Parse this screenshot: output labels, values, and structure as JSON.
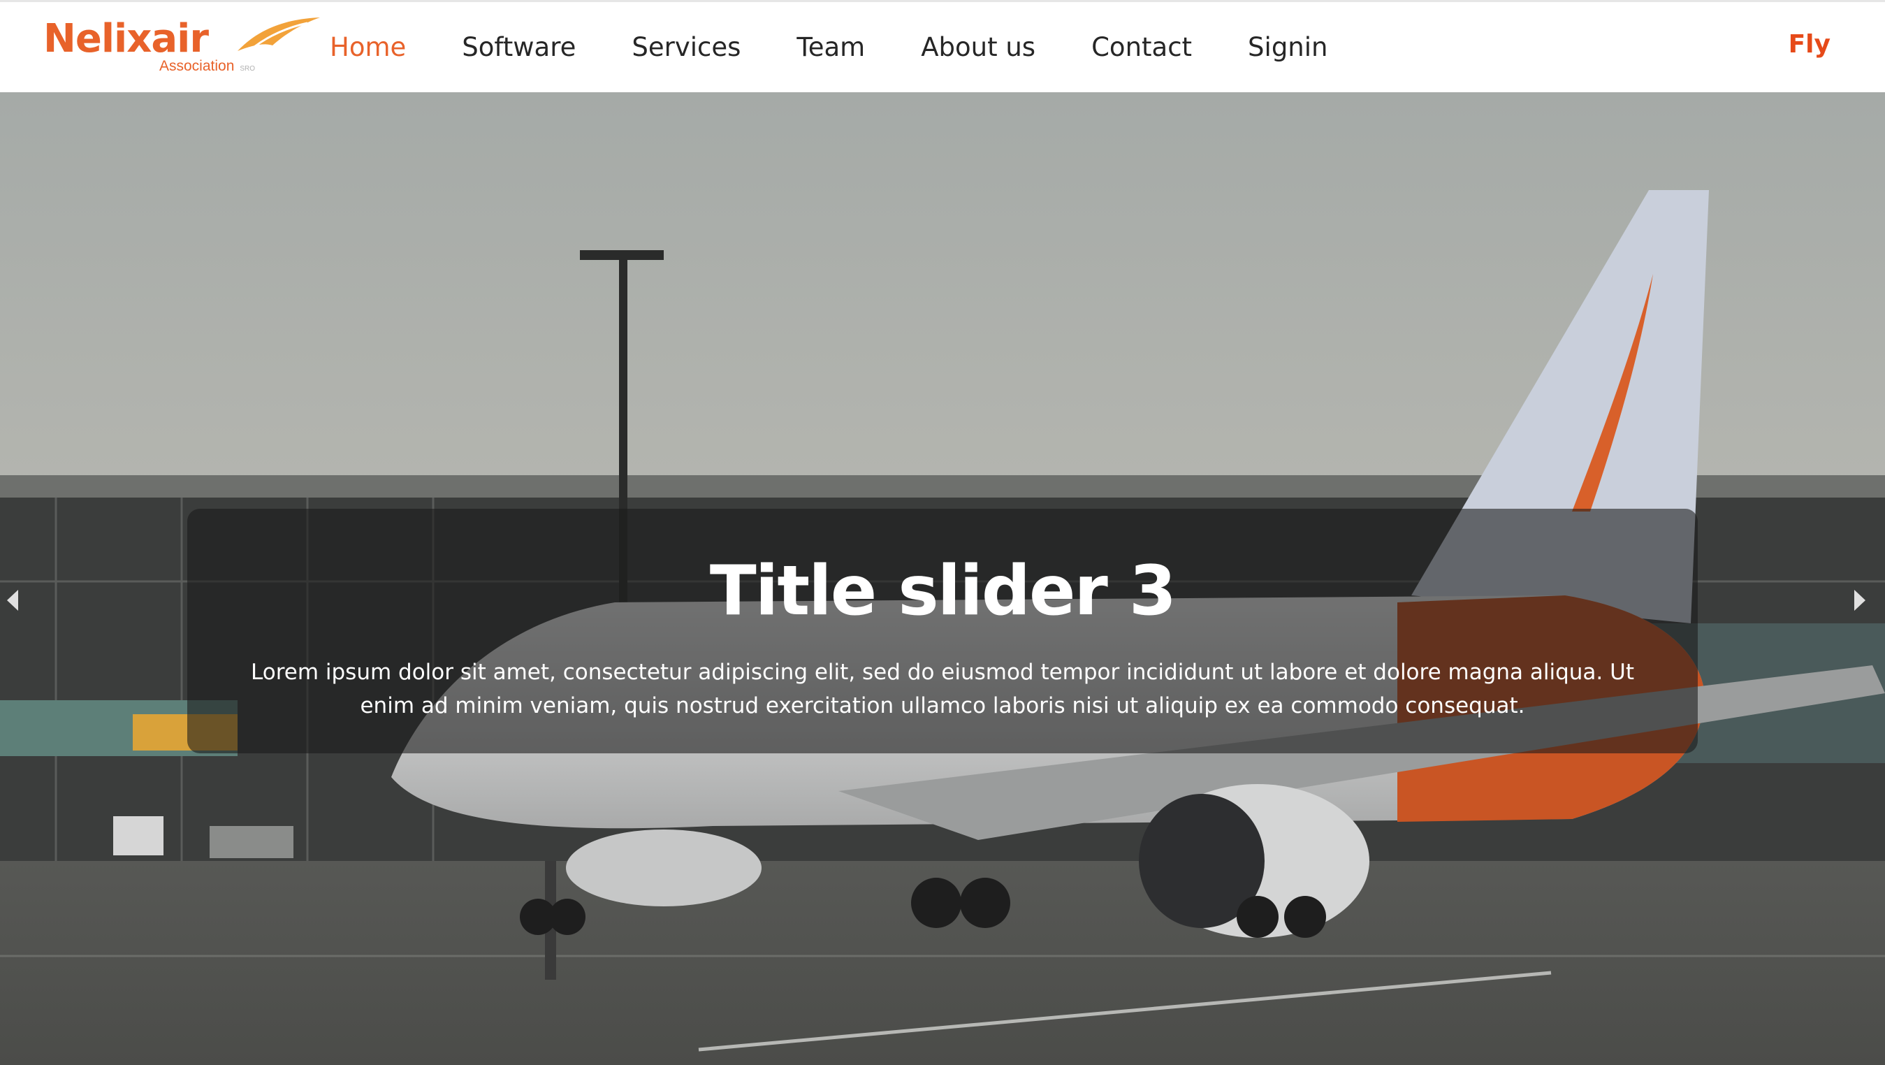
{
  "brand": {
    "name": "Nelixair",
    "tagline": "Association",
    "trademark": "SRO",
    "accent": "#e8622a"
  },
  "nav": {
    "items": [
      {
        "label": "Home",
        "active": true
      },
      {
        "label": "Software",
        "active": false
      },
      {
        "label": "Services",
        "active": false
      },
      {
        "label": "Team",
        "active": false
      },
      {
        "label": "About us",
        "active": false
      },
      {
        "label": "Contact",
        "active": false
      },
      {
        "label": "Signin",
        "active": false
      }
    ],
    "cta": "Fly"
  },
  "slider": {
    "title": "Title slider 3",
    "text": "Lorem ipsum dolor sit amet, consectetur adipiscing elit, sed do eiusmod tempor incididunt ut labore et dolore magna aliqua. Ut enim ad minim veniam, quis nostrud exercitation ullamco laboris nisi ut aliquip ex ea commodo consequat.",
    "prev_icon": "chevron-left-icon",
    "next_icon": "chevron-right-icon",
    "image": "airliner on airport apron with terminal"
  }
}
